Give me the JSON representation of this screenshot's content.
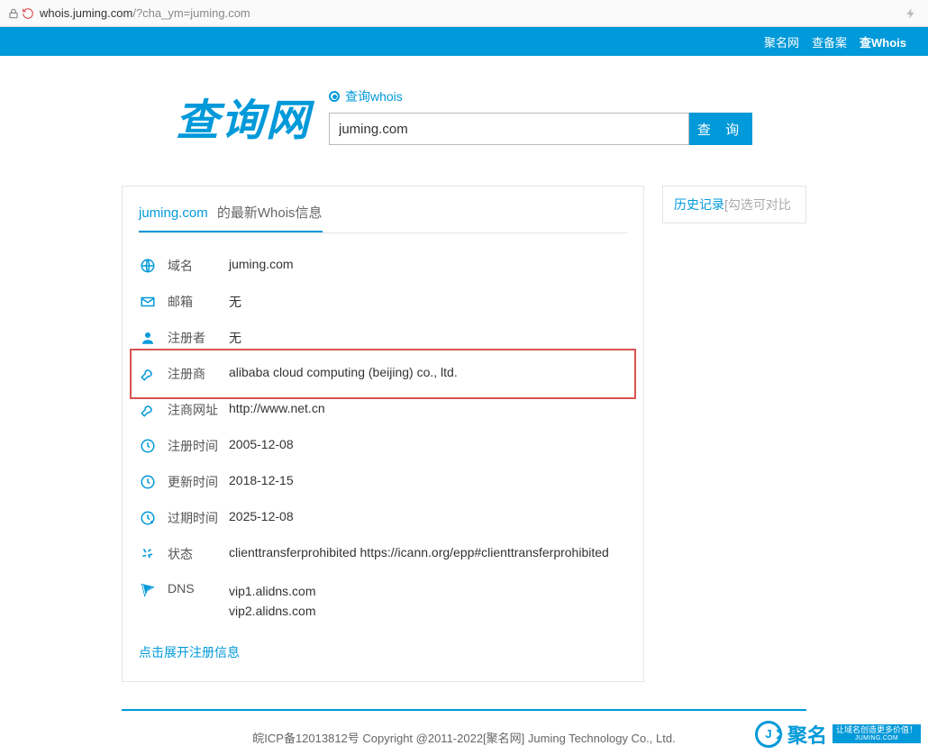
{
  "browser": {
    "domain": "whois.juming.com",
    "path": "/?cha_ym=juming.com"
  },
  "topnav": {
    "link1": "聚名网",
    "link2": "查备案",
    "link3": "查Whois"
  },
  "hero": {
    "logo": "查询网",
    "radio_label": "查询whois",
    "search_value": "juming.com",
    "search_btn": "查 询"
  },
  "tab": {
    "domain": "juming.com",
    "suffix": "的最新Whois信息"
  },
  "rows": [
    {
      "icon": "globe",
      "label": "域名",
      "value": "juming.com"
    },
    {
      "icon": "mail",
      "label": "邮箱",
      "value": "无"
    },
    {
      "icon": "person",
      "label": "注册者",
      "value": "无"
    },
    {
      "icon": "wrench",
      "label": "注册商",
      "value": "alibaba cloud computing (beijing) co., ltd.",
      "highlight": true
    },
    {
      "icon": "wrench",
      "label": "注商网址",
      "value": "http://www.net.cn"
    },
    {
      "icon": "clock",
      "label": "注册时间",
      "value": "2005-12-08"
    },
    {
      "icon": "clock",
      "label": "更新时间",
      "value": "2018-12-15"
    },
    {
      "icon": "clock-warn",
      "label": "过期时间",
      "value": "2025-12-08"
    },
    {
      "icon": "recycle",
      "label": "状态",
      "value": "clienttransferprohibited https://icann.org/epp#clienttransferprohibited"
    },
    {
      "icon": "dns",
      "label": "DNS",
      "value": "vip1.alidns.com\nvip2.alidns.com",
      "multiline": true
    }
  ],
  "expand": "点击展开注册信息",
  "side": {
    "h": "历史记录",
    "g": "[勾选可对比"
  },
  "footer": {
    "text": "皖ICP备12013812号 Copyright @2011-2022[聚名网] Juming Technology Co., Ltd.",
    "brand": "聚名",
    "slogan": "让域名创造更多价值！",
    "url": "JUMING.COM"
  }
}
